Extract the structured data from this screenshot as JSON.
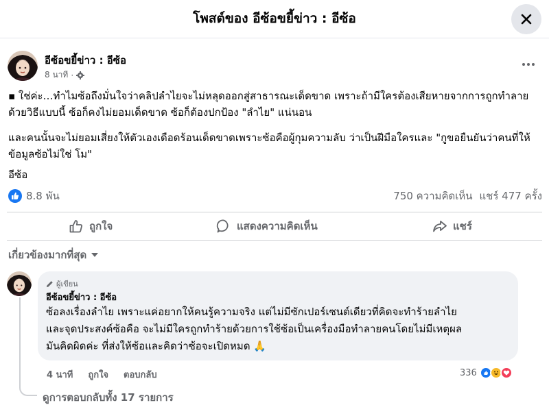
{
  "header": {
    "title": "โพสต์ของ อีซ้อขยี้ข่าว : อีซ้อ",
    "close_icon": "close-icon"
  },
  "post": {
    "author": "อีซ้อขยี้ข่าว : อีซ้อ",
    "time": "8 นาที",
    "audience_icon": "gear-icon",
    "more_icon": "more-dots-icon",
    "paragraphs": [
      "▪ ใช่ค่ะ…ทำไมซ้อถึงมั่นใจว่าคลิปลำไยจะไม่หลุดออกสู่สาธารณะเด็ดขาด เพราะถ้ามีใครต้องเสียหายจากการถูกทำลายด้วยวิธีแบบนี้ ซ้อก็คงไม่ยอมเด็ดขาด ซ้อก็ต้องปกป้อง \"ลำไย\" แน่นอน",
      "และคนนั้นจะไม่ยอมเสี่ยงให้ตัวเองเดือดร้อนเด็ดขาดเพราะซ้อคือผู้กุมความลับ ว่าเป็นฝีมือใครและ \"กูขอยืนยันว่าคนที่ให้ข้อมูลซ้อไม่ใช่ โม\"",
      "อีซ้อ"
    ],
    "likes": "8.8 พัน",
    "comments_count": "750 ความคิดเห็น",
    "shares_count": "แชร์ 477 ครั้ง",
    "colors": {
      "accent": "#1877f2",
      "muted": "#65676b"
    }
  },
  "actions": {
    "like": "ถูกใจ",
    "comment": "แสดงความคิดเห็น",
    "share": "แชร์"
  },
  "sort": {
    "label": "เกี่ยวข้องมากที่สุด"
  },
  "comment": {
    "badge": "ผู้เขียน",
    "author": "อีซ้อขยี้ข่าว : อีซ้อ",
    "lines": [
      "ซ้อลงเรื่องลำไย เพราะแค่อยากให้คนรู้ความจริง แต่ไม่มีซักเปอร์เซนต์เดียวที่คิดจะทำร้ายลำไย",
      "และจุดประสงค์ซ้อคือ จะไม่มีใครถูกทำร้ายด้วยการใช้ซ้อเป็นเครื่องมือทำลายคนโดยไม่มีเหตุผล",
      "มันคิดผิดค่ะ ที่ส่งให้ซ้อและคิดว่าซ้อจะเปิดหมด 🙏"
    ],
    "time": "4 นาที",
    "like": "ถูกใจ",
    "reply": "ตอบกลับ",
    "reaction_count": "336",
    "view_replies": "ดูการตอบกลับทั้ง 17 รายการ"
  }
}
